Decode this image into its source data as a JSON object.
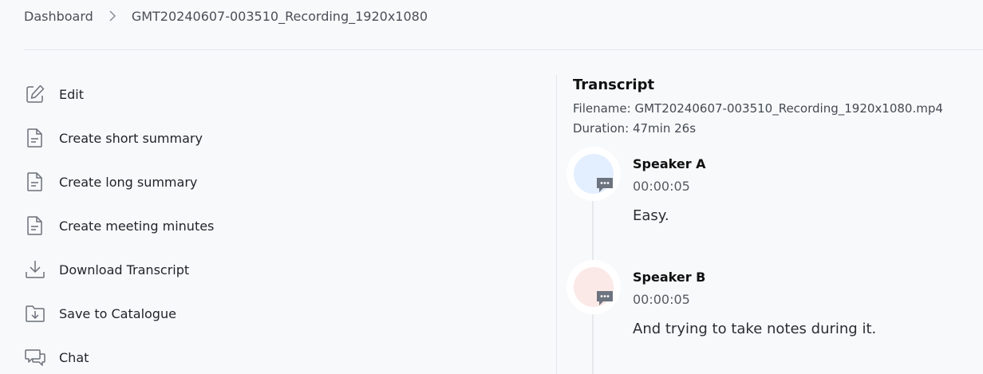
{
  "breadcrumb": {
    "root": "Dashboard",
    "current": "GMT20240607-003510_Recording_1920x1080"
  },
  "actions": [
    {
      "label": "Edit",
      "icon": "edit-icon"
    },
    {
      "label": "Create short summary",
      "icon": "document-icon"
    },
    {
      "label": "Create long summary",
      "icon": "document-icon"
    },
    {
      "label": "Create meeting minutes",
      "icon": "document-icon"
    },
    {
      "label": "Download Transcript",
      "icon": "download-icon"
    },
    {
      "label": "Save to Catalogue",
      "icon": "folder-download-icon"
    },
    {
      "label": "Chat",
      "icon": "chat-icon"
    }
  ],
  "transcript": {
    "title": "Transcript",
    "filename": "Filename: GMT20240607-003510_Recording_1920x1080.mp4",
    "duration": "Duration: 47min 26s",
    "entries": [
      {
        "speaker": "Speaker A",
        "time": "00:00:05",
        "text": "Easy.",
        "avatar_color": "#e3efff"
      },
      {
        "speaker": "Speaker B",
        "time": "00:00:05",
        "text": "And trying to take notes during it.",
        "avatar_color": "#fbe9e7"
      }
    ]
  },
  "colors": {
    "background": "#f8f9fb",
    "icon": "#6b7079",
    "divider": "#e4e6ea",
    "badge": "#6d7480"
  }
}
